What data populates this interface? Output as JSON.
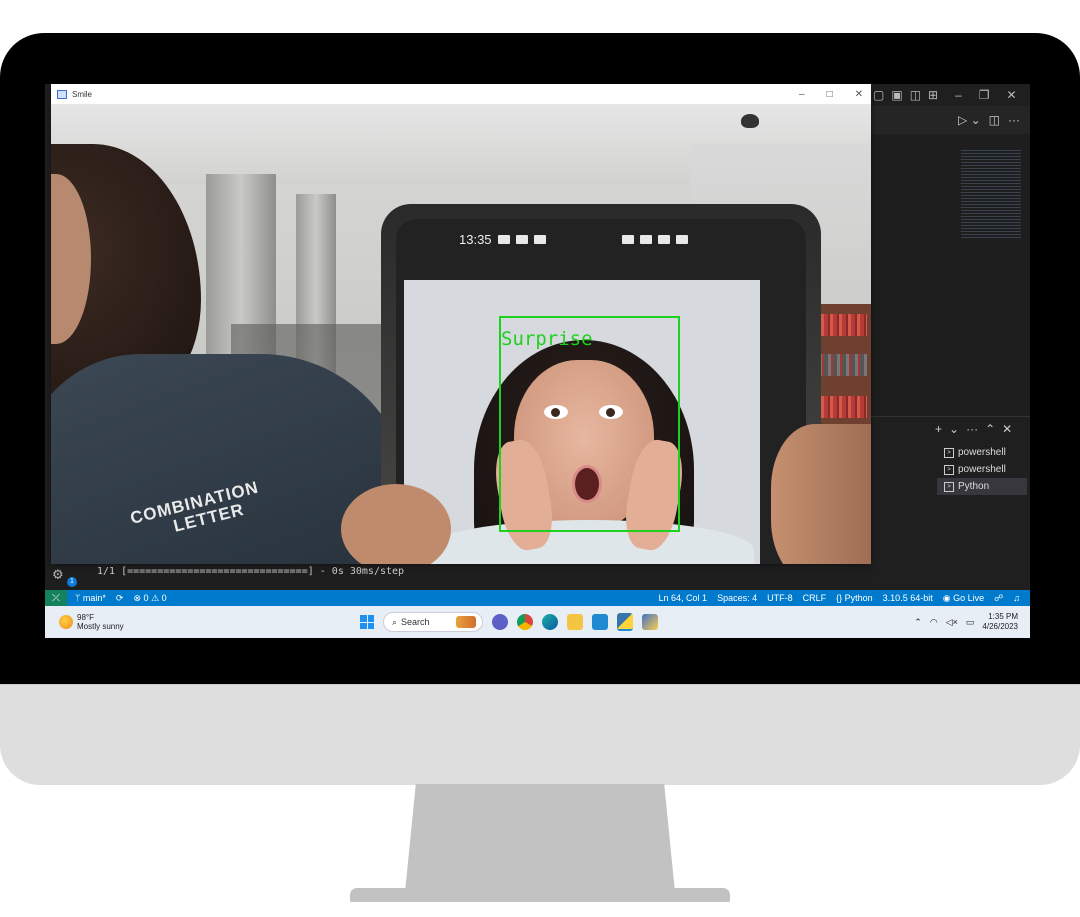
{
  "camera_window": {
    "title": "Smile",
    "controls": {
      "minimize": "–",
      "maximize": "□",
      "close": "✕"
    },
    "detection_label": "Surprise",
    "shirt_text_line1": "COMBINATION",
    "shirt_text_line2": "LETTER",
    "phone_time": "13:35"
  },
  "vscode": {
    "window_controls": {
      "minimize": "–",
      "restore": "❐",
      "close": "✕"
    },
    "panel_actions": [
      "+",
      "⌄",
      "···",
      "⌃",
      "✕"
    ],
    "terminals": [
      {
        "label": "powershell",
        "active": false
      },
      {
        "label": "powershell",
        "active": false
      },
      {
        "label": "Python",
        "active": true
      }
    ],
    "terminal_output": "1/1 [==============================] - 0s 30ms/step",
    "gear_badge": "1"
  },
  "statusbar": {
    "branch": "main*",
    "errors": "0",
    "warnings": "0",
    "position": "Ln 64, Col 1",
    "spaces": "Spaces: 4",
    "encoding": "UTF-8",
    "eol": "CRLF",
    "language": "Python",
    "interpreter": "3.10.5 64-bit",
    "go_live": "Go Live"
  },
  "taskbar": {
    "weather_temp": "98°F",
    "weather_desc": "Mostly sunny",
    "search_placeholder": "Search",
    "time": "1:35 PM",
    "date": "4/26/2023"
  },
  "colors": {
    "detection_box": "#1fd11f",
    "statusbar": "#007acc",
    "remote_indicator": "#16825d"
  }
}
